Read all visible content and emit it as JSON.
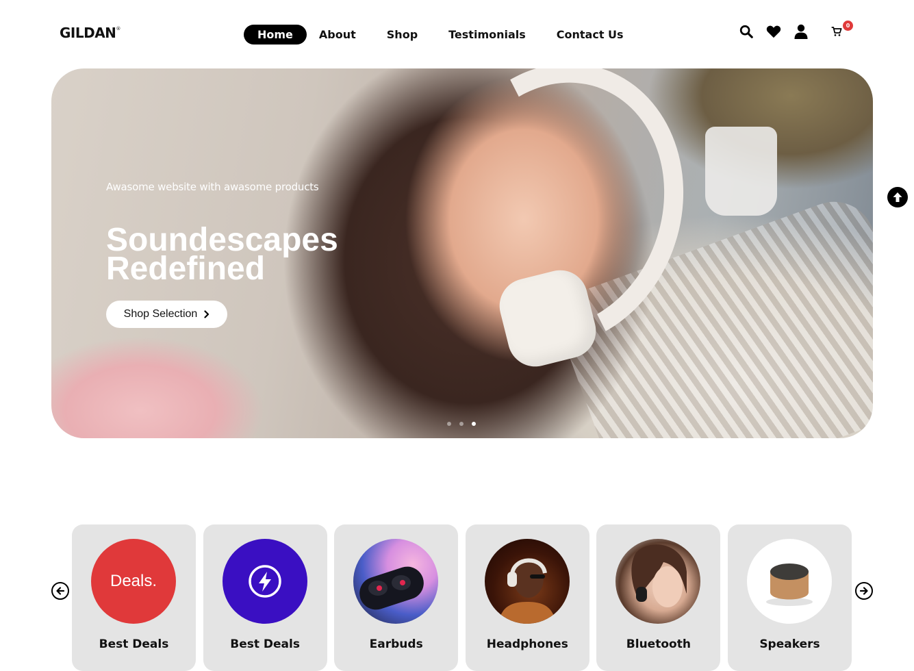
{
  "header": {
    "logo": "GILDAN",
    "logo_mark": "®",
    "nav": [
      "Home",
      "About",
      "Shop",
      "Testimonials",
      "Contact Us"
    ],
    "active_nav": "Home",
    "cart_count": "0",
    "icons": [
      "search-icon",
      "heart-icon",
      "user-icon",
      "cart-icon"
    ]
  },
  "hero": {
    "subtitle": "Awasome  website with awasome products",
    "title": "Soundescapes Redefined",
    "button_label": "Shop Selection",
    "slides": 3,
    "active_slide": 3
  },
  "categories": [
    {
      "label": "Best Deals",
      "image": "Deals."
    },
    {
      "label": "Best Deals",
      "image": "lightning-icon"
    },
    {
      "label": "Earbuds",
      "image": "earbuds-photo"
    },
    {
      "label": "Headphones",
      "image": "headphones-photo"
    },
    {
      "label": "Bluetooth",
      "image": "bluetooth-headset-photo"
    },
    {
      "label": "Speakers",
      "image": "speaker-photo"
    }
  ],
  "colors": {
    "accent": "#000000",
    "badge": "#e03a3a",
    "deals": "#e0393a",
    "flash": "#3a0fc2",
    "card_bg": "#e4e4e4"
  }
}
